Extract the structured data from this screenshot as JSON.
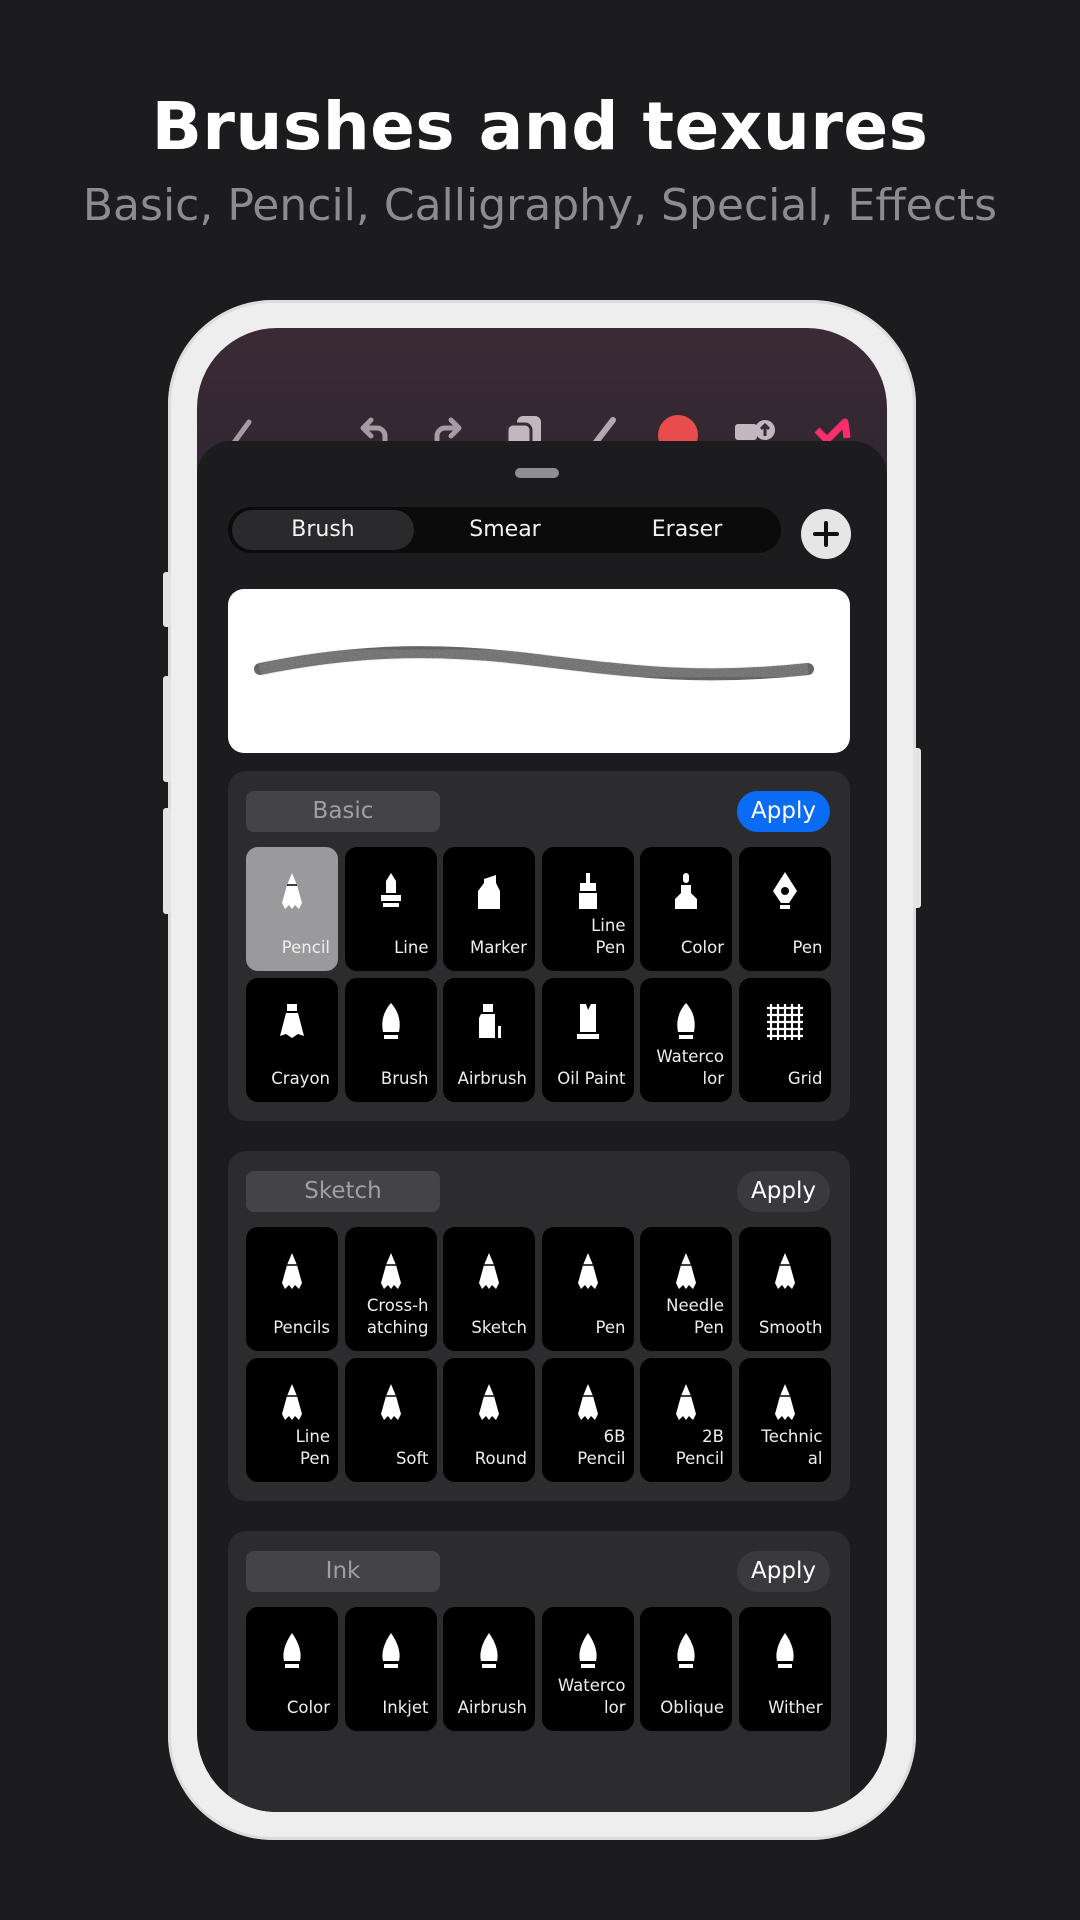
{
  "header": {
    "title": "Brushes and texures",
    "subtitle": "Basic, Pencil, Calligraphy, Special, Effects"
  },
  "toolbar": {
    "icons": [
      "back-icon",
      "undo-icon",
      "redo-icon",
      "layers-icon",
      "pencil-icon",
      "color-swatch-icon",
      "import-icon",
      "share-icon"
    ],
    "color_swatch": "#e84c4c",
    "accent": "#ff2d6a"
  },
  "segmented": {
    "items": [
      "Brush",
      "Smear",
      "Eraser"
    ],
    "selected": "Brush"
  },
  "preview": {
    "stroke": "pencil"
  },
  "sections": [
    {
      "name": "Basic",
      "apply": "Apply",
      "apply_primary": true,
      "tiles": [
        {
          "label": "Pencil",
          "icon": "pencil",
          "selected": true
        },
        {
          "label": "Line",
          "icon": "line"
        },
        {
          "label": "Marker",
          "icon": "marker"
        },
        {
          "label": "Line\nPen",
          "icon": "linepen"
        },
        {
          "label": "Color",
          "icon": "color"
        },
        {
          "label": "Pen",
          "icon": "nib"
        },
        {
          "label": "Crayon",
          "icon": "crayon"
        },
        {
          "label": "Brush",
          "icon": "brush"
        },
        {
          "label": "Airbrush",
          "icon": "airbrush"
        },
        {
          "label": "Oil Paint",
          "icon": "oil"
        },
        {
          "label": "Waterco\nlor",
          "icon": "brush"
        },
        {
          "label": "Grid",
          "icon": "grid"
        }
      ]
    },
    {
      "name": "Sketch",
      "apply": "Apply",
      "apply_primary": false,
      "tiles": [
        {
          "label": "Pencils",
          "icon": "pencil"
        },
        {
          "label": "Cross-h\natching",
          "icon": "pencil"
        },
        {
          "label": "Sketch",
          "icon": "pencil"
        },
        {
          "label": "Pen",
          "icon": "pencil"
        },
        {
          "label": "Needle\nPen",
          "icon": "pencil"
        },
        {
          "label": "Smooth",
          "icon": "pencil"
        },
        {
          "label": "Line\nPen",
          "icon": "pencil"
        },
        {
          "label": "Soft",
          "icon": "pencil"
        },
        {
          "label": "Round",
          "icon": "pencil"
        },
        {
          "label": "6B\nPencil",
          "icon": "pencil"
        },
        {
          "label": "2B\nPencil",
          "icon": "pencil"
        },
        {
          "label": "Technic\nal",
          "icon": "pencil"
        }
      ]
    },
    {
      "name": "Ink",
      "apply": "Apply",
      "apply_primary": false,
      "tiles": [
        {
          "label": "Color",
          "icon": "ink"
        },
        {
          "label": "Inkjet",
          "icon": "ink"
        },
        {
          "label": "Airbrush",
          "icon": "ink"
        },
        {
          "label": "Waterco\nlor",
          "icon": "ink"
        },
        {
          "label": "Oblique",
          "icon": "ink"
        },
        {
          "label": "Wither",
          "icon": "ink"
        }
      ]
    }
  ]
}
